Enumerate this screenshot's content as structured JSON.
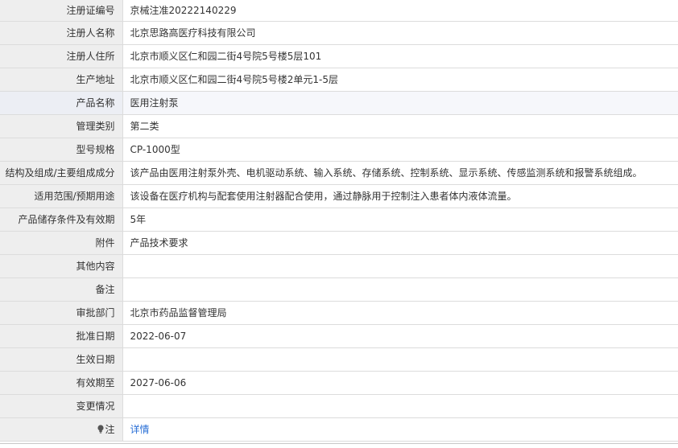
{
  "rows": [
    {
      "label": "注册证编号",
      "value": "京械注准20222140229"
    },
    {
      "label": "注册人名称",
      "value": "北京思路高医疗科技有限公司"
    },
    {
      "label": "注册人住所",
      "value": "北京市顺义区仁和园二街4号院5号楼5层101"
    },
    {
      "label": "生产地址",
      "value": "北京市顺义区仁和园二街4号院5号楼2单元1-5层"
    },
    {
      "label": "产品名称",
      "value": "医用注射泵"
    },
    {
      "label": "管理类别",
      "value": "第二类"
    },
    {
      "label": "型号规格",
      "value": "CP-1000型"
    },
    {
      "label": "结构及组成/主要组成成分",
      "value": "该产品由医用注射泵外壳、电机驱动系统、输入系统、存储系统、控制系统、显示系统、传感监测系统和报警系统组成。"
    },
    {
      "label": "适用范围/预期用途",
      "value": "该设备在医疗机构与配套使用注射器配合使用，通过静脉用于控制注入患者体内液体流量。"
    },
    {
      "label": "产品储存条件及有效期",
      "value": "5年"
    },
    {
      "label": "附件",
      "value": "产品技术要求"
    },
    {
      "label": "其他内容",
      "value": ""
    },
    {
      "label": "备注",
      "value": ""
    },
    {
      "label": "审批部门",
      "value": "北京市药品监督管理局"
    },
    {
      "label": "批准日期",
      "value": "2022-06-07"
    },
    {
      "label": "生效日期",
      "value": ""
    },
    {
      "label": "有效期至",
      "value": "2027-06-06"
    },
    {
      "label": "变更情况",
      "value": ""
    }
  ],
  "note": {
    "label": "注",
    "icon": "lightbulb-icon",
    "link_text": "详情"
  },
  "colors": {
    "label_bg": "#eeeeee",
    "highlight_row_bg": "#f6f7fb",
    "border": "#dcdcdc",
    "link": "#2a6fd6",
    "text": "#333333"
  }
}
